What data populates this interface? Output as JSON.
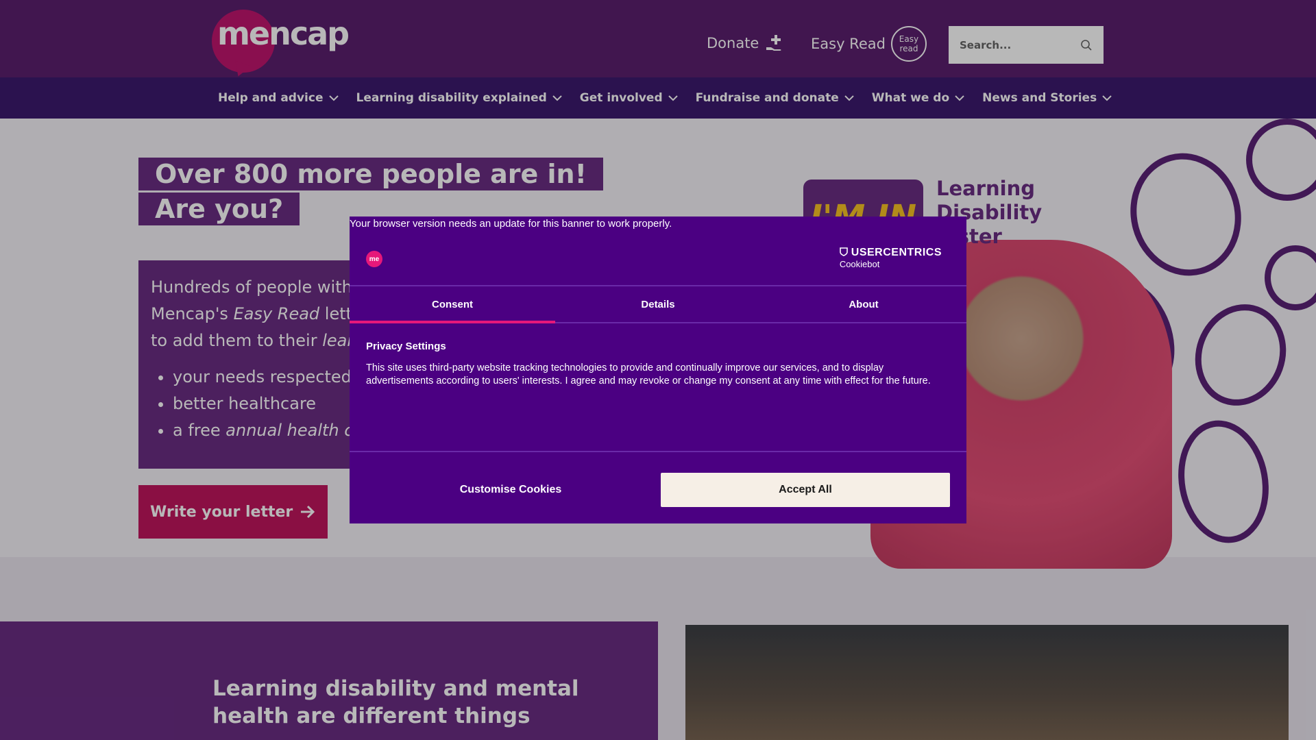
{
  "header": {
    "logo_text": "mencap",
    "donate_label": "Donate",
    "easyread_label": "Easy Read",
    "easyread_badge_line1": "Easy",
    "easyread_badge_line2": "read",
    "search_placeholder": "Search..."
  },
  "nav": {
    "items": [
      {
        "label": "Help and advice"
      },
      {
        "label": "Learning disability explained"
      },
      {
        "label": "Get involved"
      },
      {
        "label": "Fundraise and donate"
      },
      {
        "label": "What we do"
      },
      {
        "label": "News and Stories"
      }
    ]
  },
  "hero": {
    "title": "Over 800 more people are in! Are you?",
    "body_line1": "Hundreds of people with c",
    "body_line2_a": "Mencap's ",
    "body_line2_b": "Easy Read",
    "body_line2_c": " letter",
    "body_line3_a": "to add them to their ",
    "body_line3_b": "learn",
    "bullets": [
      {
        "text": "your needs respected"
      },
      {
        "text": "better healthcare"
      },
      {
        "text_a": "a free ",
        "text_b": "annual health ch"
      }
    ],
    "cta_label": "Write your letter",
    "badge_text": "I'M IN",
    "register_line1": "Learning",
    "register_line2": "Disability",
    "register_line3": "gister"
  },
  "lower": {
    "title": "Learning disability and mental health are different things"
  },
  "cookie_banner": {
    "warning": "Your browser version needs an update for this banner to work properly.",
    "logo_text": "me",
    "brand_name": "USERCENTRICS",
    "brand_sub": "Cookiebot",
    "tabs": [
      {
        "label": "Consent"
      },
      {
        "label": "Details"
      },
      {
        "label": "About"
      }
    ],
    "heading": "Privacy Settings",
    "text": "This site uses third-party website tracking technologies to provide and continually improve our services, and to display advertisements according to users' interests. I agree and may revoke or change my consent at any time with effect for the future.",
    "customise_label": "Customise Cookies",
    "accept_label": "Accept All"
  },
  "colors": {
    "brand_purple": "#5a1f6e",
    "nav_purple": "#3c1a6e",
    "banner_purple": "#4b0082",
    "accent_pink": "#c0165e"
  }
}
